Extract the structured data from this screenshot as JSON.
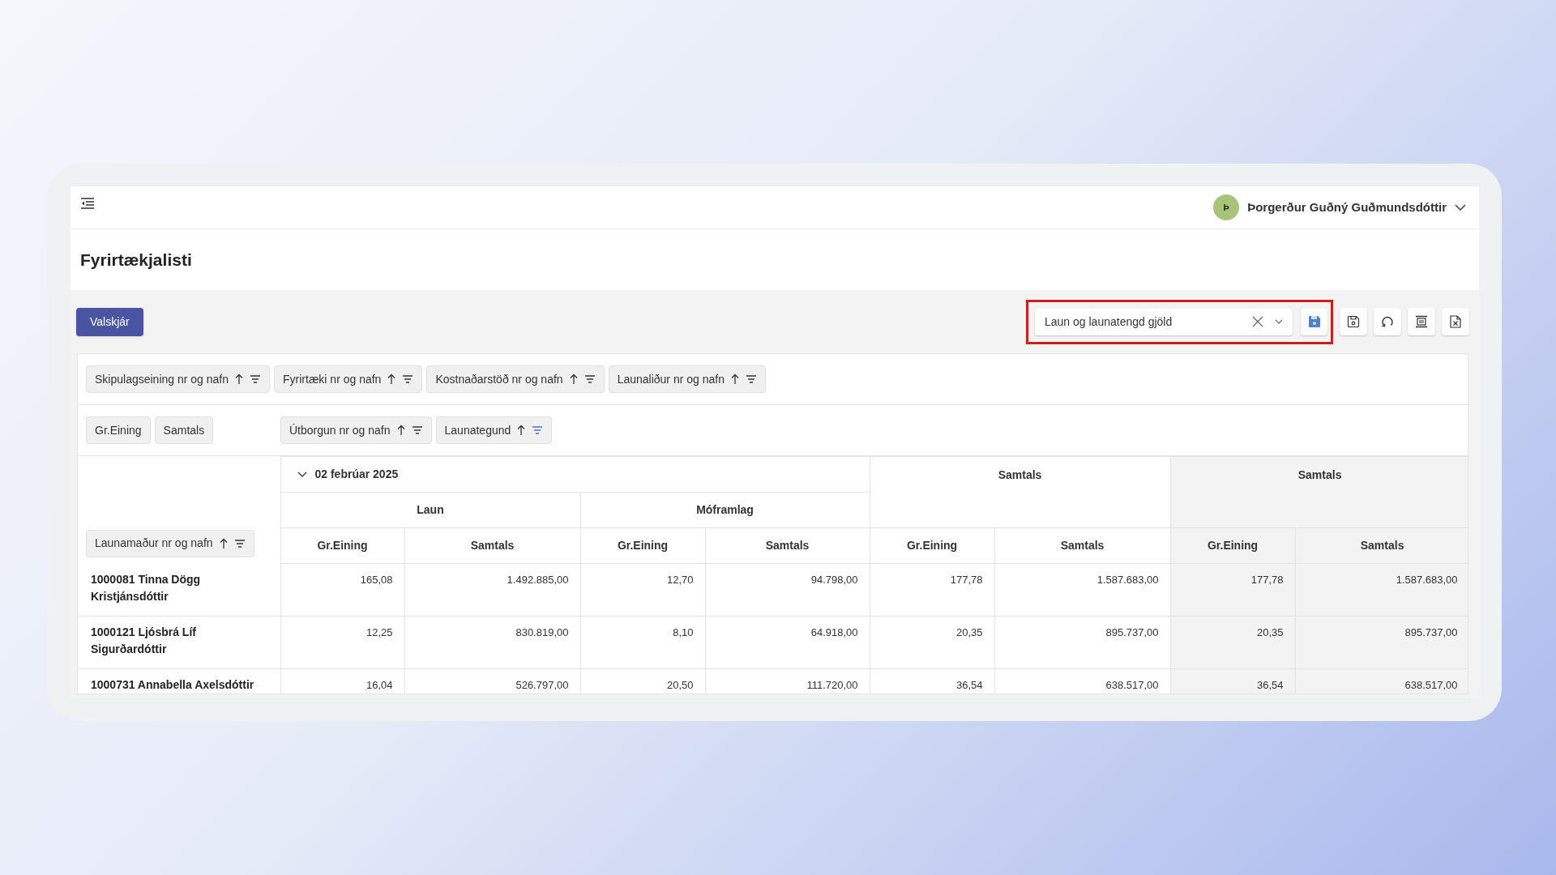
{
  "header": {
    "user": {
      "initial": "Þ",
      "name": "Þorgerður Guðný Guðmundsdóttir"
    }
  },
  "page_title": "Fyrirtækjalisti",
  "toolbar": {
    "button": "Valskjár",
    "layout_select": {
      "value": "Laun og launatengd gjöld",
      "highlighted": true
    }
  },
  "filter_fields": [
    {
      "label": "Skipulagseining nr og nafn",
      "filter_active": false
    },
    {
      "label": "Fyrirtæki nr og nafn",
      "filter_active": false
    },
    {
      "label": "Kostnaðarstöð nr og nafn",
      "filter_active": false
    },
    {
      "label": "Launaliður nr og nafn",
      "filter_active": false
    }
  ],
  "value_fields": [
    "Gr.Eining",
    "Samtals"
  ],
  "column_fields": [
    {
      "label": "Útborgun nr og nafn",
      "filter_active": false
    },
    {
      "label": "Launategund",
      "filter_active": true
    }
  ],
  "row_fields": [
    {
      "label": "Launamaður nr og nafn",
      "filter_active": false
    }
  ],
  "table": {
    "date_group": {
      "label": "02 febrúar 2025",
      "expanded": true
    },
    "groups": [
      "Laun",
      "Móframlag"
    ],
    "date_total": "Samtals",
    "grand_total": "Samtals",
    "measures": [
      "Gr.Eining",
      "Samtals",
      "Gr.Eining",
      "Samtals",
      "Gr.Eining",
      "Samtals",
      "Gr.Eining",
      "Samtals"
    ],
    "rows": [
      {
        "employee": "1000081 Tinna Dögg Kristjánsdóttir",
        "values": [
          "165,08",
          "1.492.885,00",
          "12,70",
          "94.798,00",
          "177,78",
          "1.587.683,00",
          "177,78",
          "1.587.683,00"
        ]
      },
      {
        "employee": "1000121 Ljósbrá Líf Sigurðardóttir",
        "values": [
          "12,25",
          "830.819,00",
          "8,10",
          "64.918,00",
          "20,35",
          "895.737,00",
          "20,35",
          "895.737,00"
        ]
      },
      {
        "employee": "1000731 Annabella Axelsdóttir",
        "values": [
          "16,04",
          "526.797,00",
          "20,50",
          "111.720,00",
          "36,54",
          "638.517,00",
          "36,54",
          "638.517,00"
        ]
      }
    ]
  }
}
